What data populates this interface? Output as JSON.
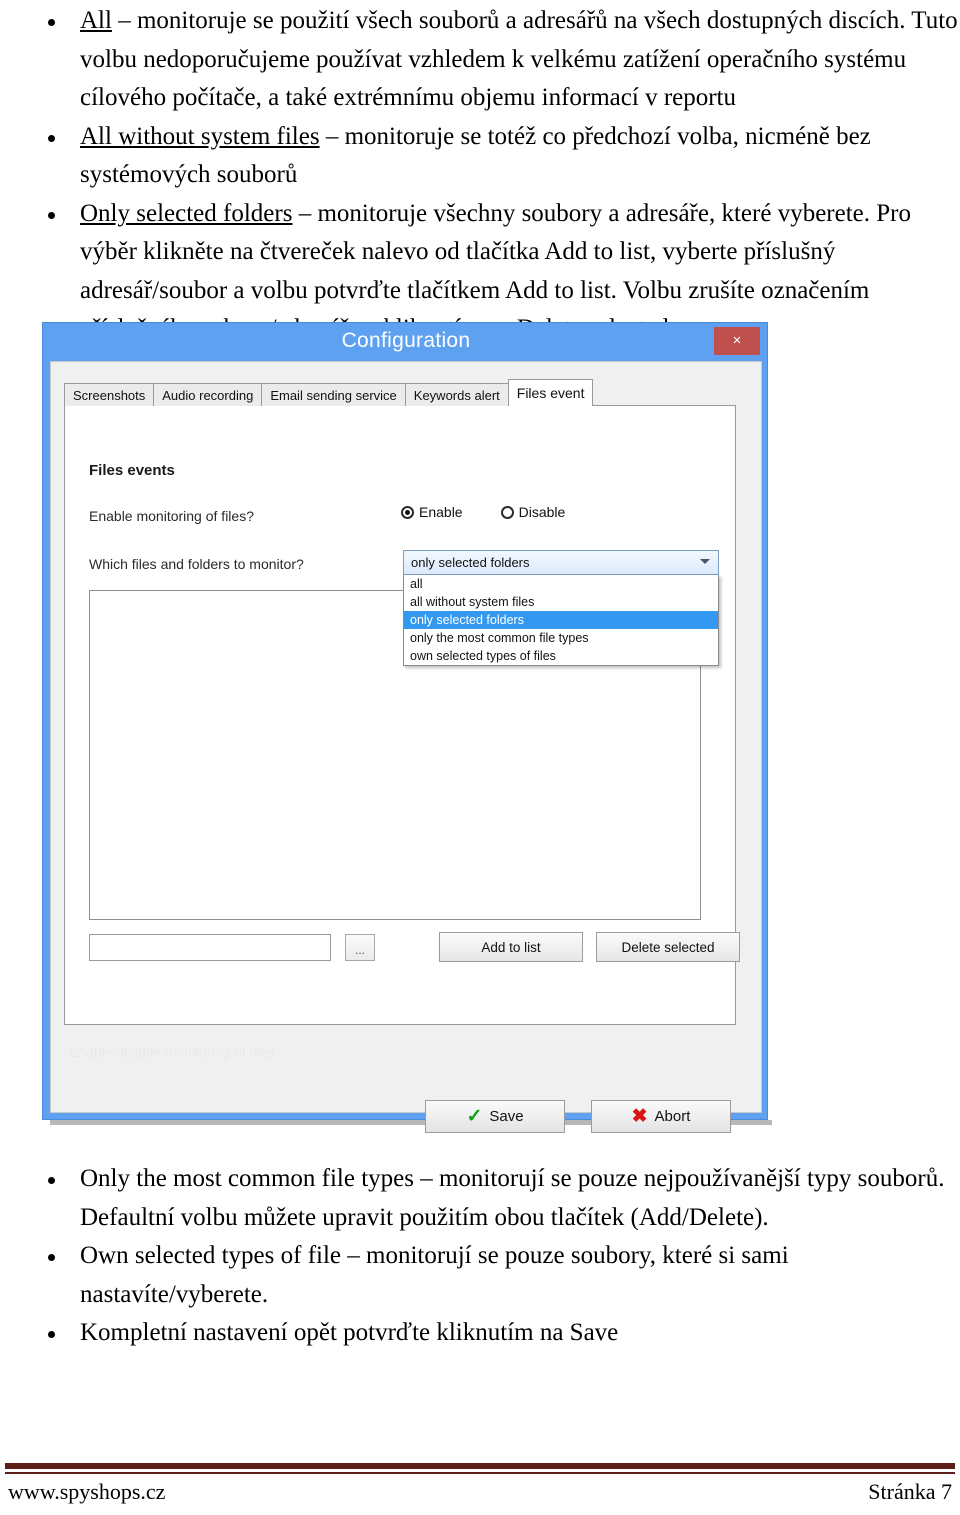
{
  "document": {
    "top_paragraphs": [
      {
        "term": "All",
        "rest": " – monitoruje se použití všech souborů a adresářů na všech dostupných discích. Tuto volbu nedoporučujeme používat vzhledem k velkému zatížení operačního systému cílového počítače, a také extrémnímu objemu informací v reportu"
      },
      {
        "term": "All without system files",
        "rest": " – monitoruje se totéž co předchozí volba, nicméně bez systémových souborů"
      },
      {
        "term": "Only selected folders",
        "rest": " – monitoruje všechny soubory a adresáře, které vyberete. Pro výběr klikněte na čtvereček nalevo od tlačítka Add to list, vyberte příslušný adresář/soubor a volbu potvrďte tlačítkem Add to list. Volbu zrušíte označením příslušného soboru/adresáře a kliknutím na Delete selected."
      }
    ],
    "bottom_paragraphs": [
      {
        "term": "Only the most common file types",
        "rest": " – monitorují se pouze nejpoužívanější typy souborů. Defaultní volbu můžete upravit použitím obou tlačítek (Add/Delete)."
      },
      {
        "term": "Own selected types of file",
        "rest": " – monitorují se pouze soubory, které si sami nastavíte/vyberete."
      },
      {
        "term": "",
        "rest": "Kompletní nastavení opět potvrďte kliknutím na Save"
      }
    ]
  },
  "dialog": {
    "title": "Configuration",
    "close_label": "×",
    "tabs": [
      {
        "label": "Screenshots",
        "active": false
      },
      {
        "label": "Audio recording",
        "active": false
      },
      {
        "label": "Email sending service",
        "active": false
      },
      {
        "label": "Keywords alert",
        "active": false
      },
      {
        "label": "Files event",
        "active": true
      }
    ],
    "group_title": "Files events",
    "enable_label": "Enable monitoring of files?",
    "radios": [
      {
        "label": "Enable",
        "selected": true
      },
      {
        "label": "Disable",
        "selected": false
      }
    ],
    "which_label": "Which files and folders to monitor?",
    "combo": {
      "value": "only selected folders",
      "options": [
        {
          "label": "all",
          "selected": false
        },
        {
          "label": "all without system files",
          "selected": false
        },
        {
          "label": "only selected folders",
          "selected": true
        },
        {
          "label": "only the most common file types",
          "selected": false
        },
        {
          "label": "own selected types of files",
          "selected": false
        }
      ]
    },
    "path_value": "",
    "browse_label": "...",
    "add_label": "Add to list",
    "delete_label": "Delete selected",
    "faded_note": "Enable/disable monitoring of files",
    "save_label": "Save",
    "abort_label": "Abort",
    "save_icon": "check-icon",
    "abort_icon": "x-mark-icon",
    "colors": {
      "titlebar": "#5ea1f0",
      "close_button": "#c0504d",
      "selection": "#3399f0",
      "save_check": "#13a013",
      "abort_x": "#d81616"
    }
  },
  "footer": {
    "site": "www.spyshops.cz",
    "page": "Stránka 7",
    "rule_color": "#5c1f1a"
  }
}
